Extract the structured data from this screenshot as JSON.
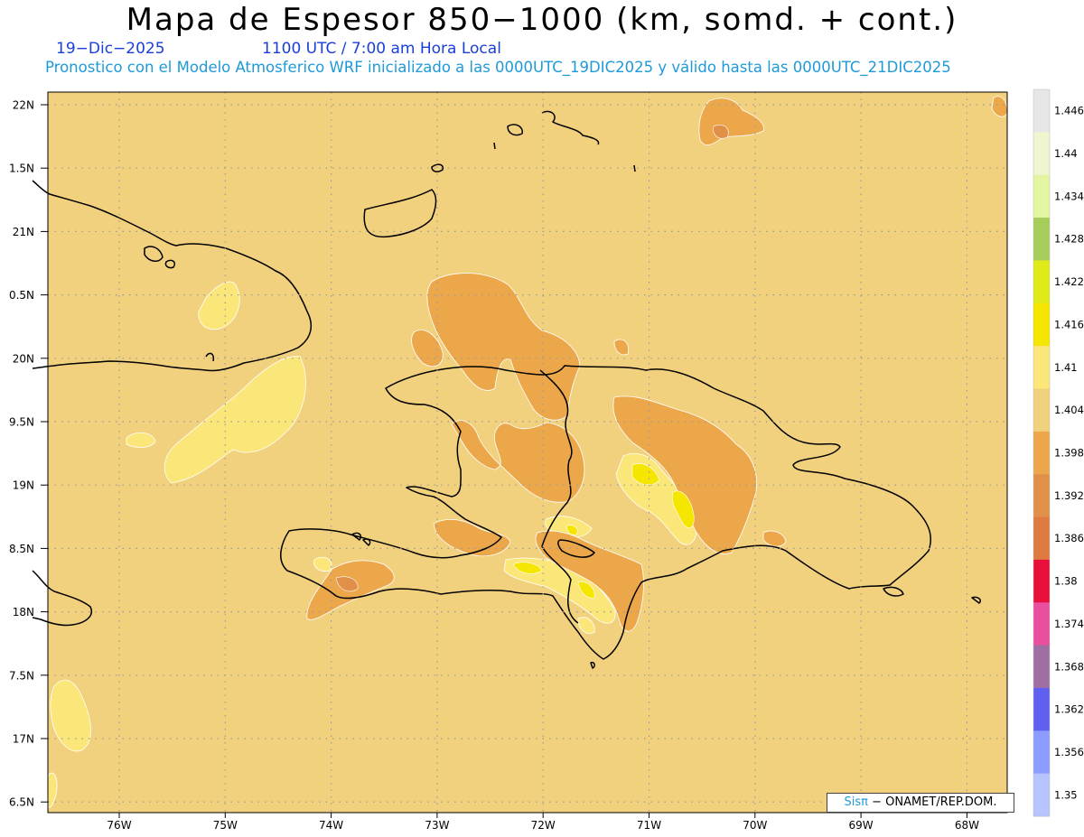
{
  "header": {
    "title": "Mapa de Espesor 850−1000 (km, somd. + cont.)",
    "date": "19−Dic−2025",
    "time": "1100 UTC / 7:00 am Hora Local",
    "forecast": "Pronostico con el Modelo Atmosferico WRF inicializado a las 0000UTC_19DIC2025 y válido hasta las  0000UTC_21DIC2025"
  },
  "axes": {
    "lat_labels": [
      "22N",
      "1.5N",
      "21N",
      "0.5N",
      "20N",
      "9.5N",
      "19N",
      "8.5N",
      "18N",
      "7.5N",
      "17N",
      "6.5N"
    ],
    "lon_labels": [
      "76W",
      "75W",
      "74W",
      "73W",
      "72W",
      "71W",
      "70W",
      "69W",
      "68W"
    ]
  },
  "colorbar": {
    "labels": [
      "1.446",
      "1.44",
      "1.434",
      "1.428",
      "1.422",
      "1.416",
      "1.41",
      "1.404",
      "1.398",
      "1.392",
      "1.386",
      "1.38",
      "1.374",
      "1.368",
      "1.362",
      "1.356",
      "1.35"
    ],
    "colors": [
      "#e6e6e6",
      "#f0f5d0",
      "#e3f5a0",
      "#a6cc5c",
      "#e0ea18",
      "#f5e600",
      "#fbe67a",
      "#f2d17e",
      "#eba74a",
      "#e1904a",
      "#df7a40",
      "#e8103a",
      "#e8509e",
      "#9f6fa4",
      "#6060f0",
      "#8c9cff",
      "#b6c4ff"
    ]
  },
  "credit": {
    "brand": "Sisπ",
    "text": " − ONAMET/REP.DOM."
  }
}
